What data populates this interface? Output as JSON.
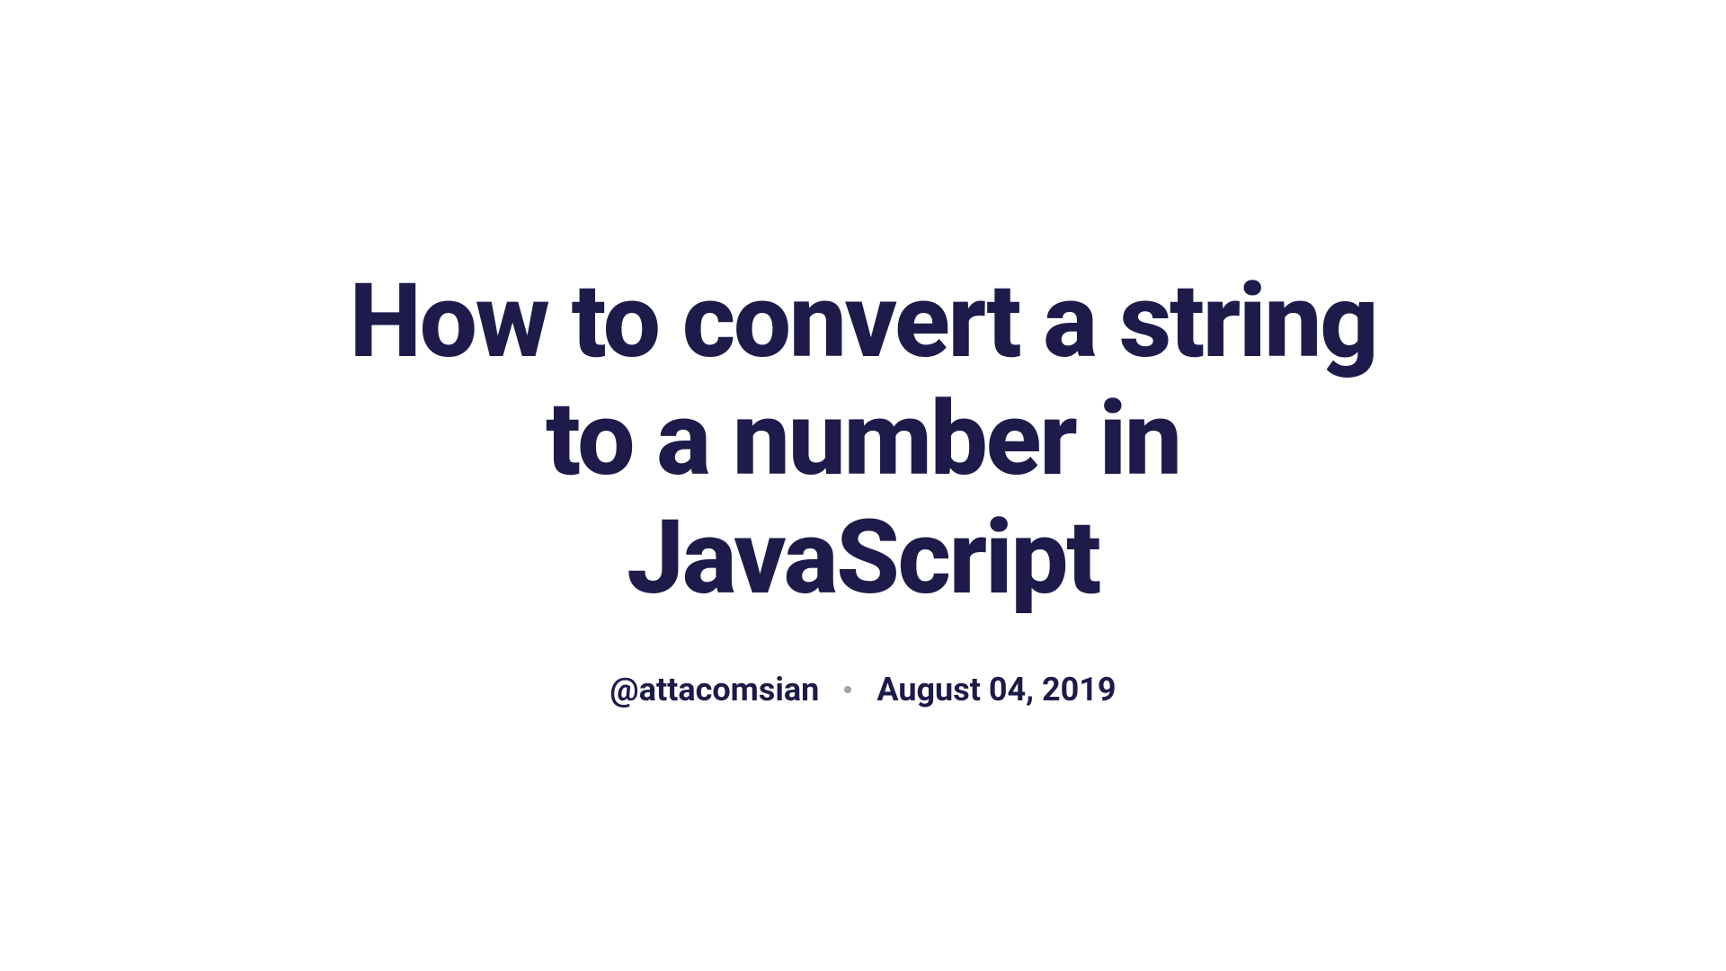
{
  "article": {
    "title": "How to convert a string to a number in JavaScript",
    "author": "@attacomsian",
    "date": "August 04, 2019"
  }
}
